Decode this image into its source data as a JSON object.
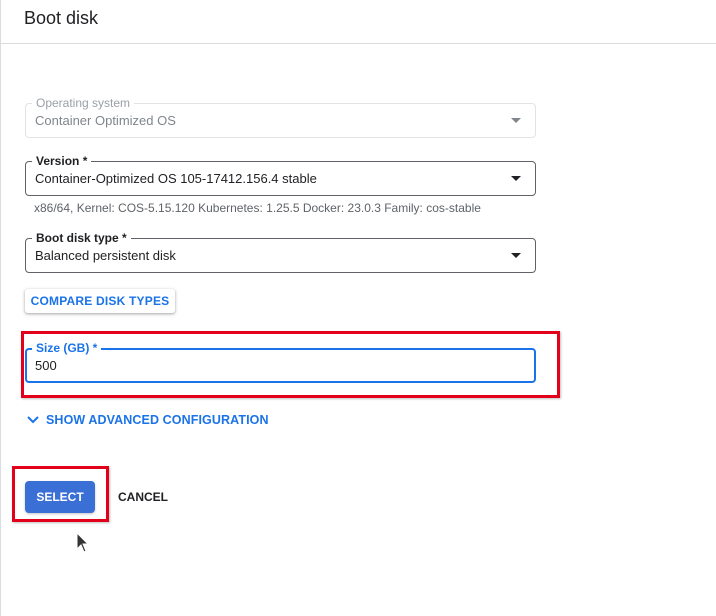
{
  "header": {
    "title": "Boot disk"
  },
  "operating_system": {
    "label": "Operating system",
    "value": "Container Optimized OS"
  },
  "version": {
    "label": "Version *",
    "value": "Container-Optimized OS 105-17412.156.4 stable",
    "helper": "x86/64, Kernel: COS-5.15.120 Kubernetes: 1.25.5 Docker: 23.0.3 Family: cos-stable"
  },
  "boot_disk_type": {
    "label": "Boot disk type *",
    "value": "Balanced persistent disk"
  },
  "compare_button": {
    "label": "COMPARE DISK TYPES"
  },
  "size": {
    "label": "Size (GB) *",
    "value": "500"
  },
  "advanced": {
    "label": "SHOW ADVANCED CONFIGURATION"
  },
  "actions": {
    "select_label": "SELECT",
    "cancel_label": "CANCEL"
  },
  "colors": {
    "accent": "#1a73e8",
    "primary_button": "#3a6fd6",
    "highlight_box": "#e3001b"
  },
  "icons": {
    "dropdown": "chevron-down-icon",
    "advanced": "chevron-down-icon",
    "cursor": "mouse-pointer-icon"
  }
}
